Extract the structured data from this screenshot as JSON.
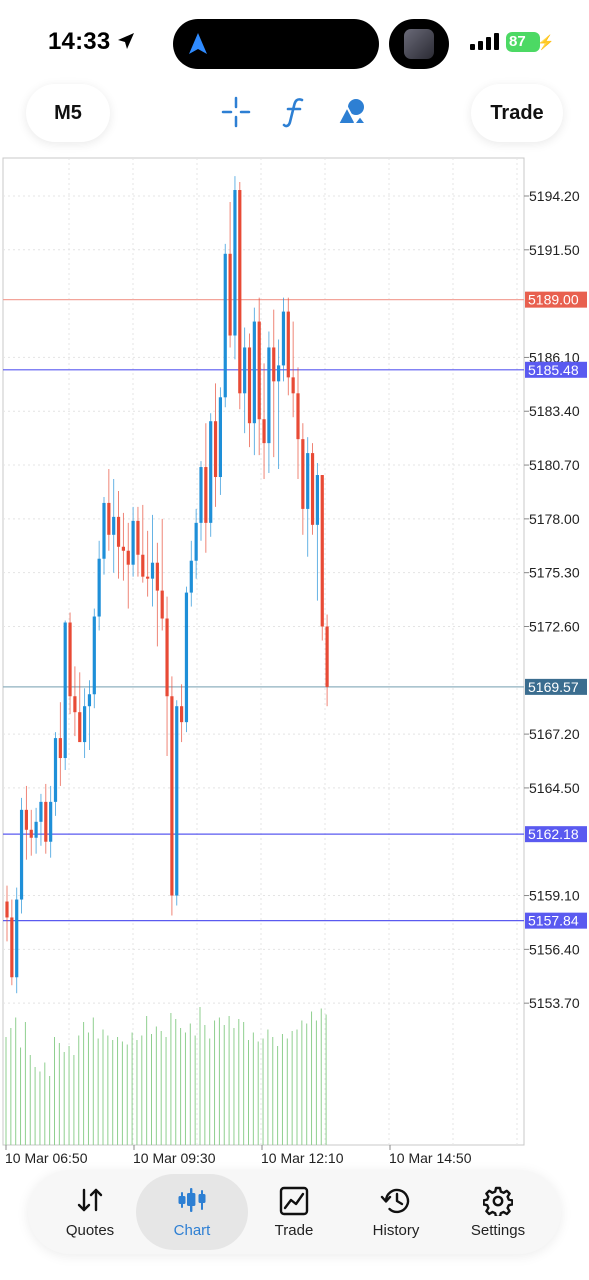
{
  "status": {
    "time": "14:33",
    "battery": "87"
  },
  "toolbar": {
    "timeframe": "M5",
    "trade_label": "Trade",
    "icons": [
      "crosshair-icon",
      "function-icon",
      "shapes-icon"
    ]
  },
  "price_levels": {
    "red": "5189.00",
    "blue1": "5185.48",
    "current": "5169.57",
    "blue2": "5162.18",
    "blue3": "5157.84"
  },
  "colors": {
    "bull": "#1e8fd8",
    "bear": "#e84a35",
    "level_line": "#5a5af0",
    "volume": "#8fcf8f",
    "accent": "#2d7fd3"
  },
  "chart_data": {
    "type": "candlestick",
    "y_ticks": [
      "5194.20",
      "5191.50",
      "5186.10",
      "5183.40",
      "5180.70",
      "5178.00",
      "5175.30",
      "5172.60",
      "5167.20",
      "5164.50",
      "5159.10",
      "5156.40",
      "5153.70"
    ],
    "x_ticks": [
      "10 Mar 06:50",
      "10 Mar 09:30",
      "10 Mar 12:10",
      "10 Mar 14:50"
    ],
    "ylim": [
      5151.0,
      5196.5
    ],
    "candles": [
      [
        5158.8,
        5159.6,
        5156.8,
        5158.0
      ],
      [
        5158.0,
        5158.9,
        5154.6,
        5155.0
      ],
      [
        5155.0,
        5159.5,
        5154.2,
        5158.9
      ],
      [
        5158.9,
        5164.0,
        5158.2,
        5163.4
      ],
      [
        5163.4,
        5164.6,
        5160.9,
        5162.4
      ],
      [
        5162.4,
        5163.4,
        5161.1,
        5162.0
      ],
      [
        5162.0,
        5163.5,
        5161.2,
        5162.8
      ],
      [
        5162.8,
        5164.2,
        5161.6,
        5163.8
      ],
      [
        5163.8,
        5164.7,
        5161.2,
        5161.8
      ],
      [
        5161.8,
        5164.6,
        5161.0,
        5163.8
      ],
      [
        5163.8,
        5167.3,
        5163.1,
        5167.0
      ],
      [
        5167.0,
        5168.8,
        5164.6,
        5166.0
      ],
      [
        5166.0,
        5172.9,
        5165.4,
        5172.8
      ],
      [
        5172.8,
        5173.3,
        5168.2,
        5169.1
      ],
      [
        5169.1,
        5170.6,
        5167.1,
        5168.3
      ],
      [
        5168.3,
        5170.3,
        5167.0,
        5166.8
      ],
      [
        5166.8,
        5169.5,
        5166.0,
        5168.6
      ],
      [
        5168.6,
        5169.9,
        5166.4,
        5169.2
      ],
      [
        5169.2,
        5173.5,
        5168.5,
        5173.1
      ],
      [
        5173.1,
        5176.9,
        5172.4,
        5176.0
      ],
      [
        5176.0,
        5179.1,
        5175.2,
        5178.8
      ],
      [
        5178.8,
        5180.5,
        5176.4,
        5177.2
      ],
      [
        5177.2,
        5180.0,
        5175.3,
        5178.1
      ],
      [
        5178.1,
        5179.4,
        5175.0,
        5176.6
      ],
      [
        5176.6,
        5178.3,
        5174.9,
        5176.4
      ],
      [
        5176.4,
        5177.8,
        5173.5,
        5175.7
      ],
      [
        5175.7,
        5178.6,
        5175.1,
        5177.9
      ],
      [
        5177.9,
        5178.6,
        5175.1,
        5176.2
      ],
      [
        5176.2,
        5178.7,
        5174.8,
        5175.1
      ],
      [
        5175.1,
        5177.4,
        5174.1,
        5175.0
      ],
      [
        5175.0,
        5178.2,
        5173.6,
        5175.8
      ],
      [
        5175.8,
        5176.8,
        5171.6,
        5174.4
      ],
      [
        5174.4,
        5178.0,
        5172.4,
        5173.0
      ],
      [
        5173.0,
        5174.1,
        5166.1,
        5169.1
      ],
      [
        5169.1,
        5170.1,
        5158.1,
        5159.1
      ],
      [
        5159.1,
        5168.9,
        5158.6,
        5168.6
      ],
      [
        5168.6,
        5169.7,
        5166.8,
        5167.8
      ],
      [
        5167.8,
        5174.6,
        5167.3,
        5174.3
      ],
      [
        5174.3,
        5176.9,
        5173.6,
        5175.9
      ],
      [
        5175.9,
        5178.5,
        5175.0,
        5177.8
      ],
      [
        5177.8,
        5180.9,
        5176.9,
        5180.6
      ],
      [
        5180.6,
        5182.8,
        5176.3,
        5177.8
      ],
      [
        5177.8,
        5183.3,
        5177.1,
        5182.9
      ],
      [
        5182.9,
        5184.8,
        5178.6,
        5180.1
      ],
      [
        5180.1,
        5184.6,
        5179.2,
        5184.1
      ],
      [
        5184.1,
        5191.8,
        5183.6,
        5191.3
      ],
      [
        5191.3,
        5193.9,
        5186.6,
        5187.2
      ],
      [
        5187.2,
        5195.2,
        5186.0,
        5194.5
      ],
      [
        5194.5,
        5194.9,
        5183.5,
        5184.3
      ],
      [
        5184.3,
        5187.6,
        5182.3,
        5186.6
      ],
      [
        5186.6,
        5187.3,
        5181.6,
        5182.8
      ],
      [
        5182.8,
        5188.6,
        5181.2,
        5187.9
      ],
      [
        5187.9,
        5189.1,
        5181.2,
        5183.0
      ],
      [
        5183.0,
        5185.8,
        5180.0,
        5181.8
      ],
      [
        5181.8,
        5187.4,
        5180.3,
        5186.6
      ],
      [
        5186.6,
        5188.5,
        5181.1,
        5184.9
      ],
      [
        5184.9,
        5187.0,
        5180.5,
        5185.7
      ],
      [
        5185.7,
        5189.1,
        5184.9,
        5188.4
      ],
      [
        5188.4,
        5189.1,
        5184.2,
        5185.1
      ],
      [
        5185.1,
        5187.9,
        5183.1,
        5184.3
      ],
      [
        5184.3,
        5185.6,
        5180.0,
        5182.0
      ],
      [
        5182.0,
        5182.8,
        5177.2,
        5178.5
      ],
      [
        5178.5,
        5182.1,
        5176.1,
        5181.3
      ],
      [
        5181.3,
        5181.8,
        5177.2,
        5177.7
      ],
      [
        5177.7,
        5180.8,
        5173.9,
        5180.2
      ],
      [
        5180.2,
        5180.2,
        5171.9,
        5172.6
      ],
      [
        5172.6,
        5173.2,
        5168.6,
        5169.57
      ]
    ],
    "volume_rel": [
      0.72,
      0.78,
      0.85,
      0.65,
      0.82,
      0.6,
      0.52,
      0.49,
      0.55,
      0.46,
      0.72,
      0.68,
      0.62,
      0.66,
      0.6,
      0.73,
      0.82,
      0.75,
      0.85,
      0.71,
      0.77,
      0.73,
      0.7,
      0.72,
      0.69,
      0.67,
      0.75,
      0.7,
      0.73,
      0.86,
      0.74,
      0.79,
      0.76,
      0.72,
      0.88,
      0.84,
      0.78,
      0.75,
      0.81,
      0.73,
      0.92,
      0.8,
      0.71,
      0.83,
      0.85,
      0.8,
      0.86,
      0.78,
      0.84,
      0.82,
      0.7,
      0.75,
      0.69,
      0.71,
      0.77,
      0.72,
      0.66,
      0.74,
      0.71,
      0.76,
      0.77,
      0.83,
      0.81,
      0.89,
      0.83,
      0.91,
      0.87
    ]
  },
  "tabs": [
    {
      "label": "Quotes",
      "icon": "quotes-icon"
    },
    {
      "label": "Chart",
      "icon": "chart-icon",
      "active": true
    },
    {
      "label": "Trade",
      "icon": "trade-icon"
    },
    {
      "label": "History",
      "icon": "history-icon"
    },
    {
      "label": "Settings",
      "icon": "settings-icon"
    }
  ]
}
